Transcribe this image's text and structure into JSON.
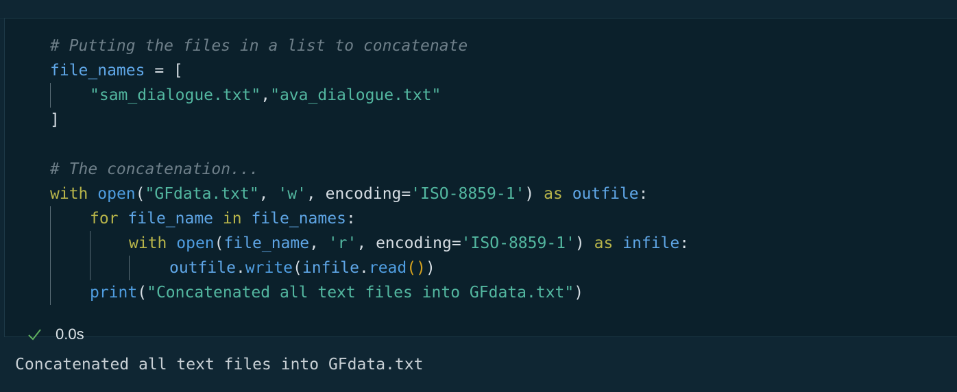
{
  "cell": {
    "code_lines": [
      {
        "tokens": [
          {
            "cls": "cmt",
            "text": "# Putting the files in a list to concatenate"
          }
        ]
      },
      {
        "tokens": [
          {
            "cls": "var",
            "text": "file_names"
          },
          {
            "cls": "op",
            "text": " = "
          },
          {
            "cls": "par",
            "text": "["
          }
        ]
      },
      {
        "tokens": [
          {
            "cls": "str",
            "text": "\"sam_dialogue.txt\""
          },
          {
            "cls": "op",
            "text": ","
          },
          {
            "cls": "str",
            "text": "\"ava_dialogue.txt\""
          }
        ]
      },
      {
        "tokens": [
          {
            "cls": "par",
            "text": "]"
          }
        ]
      },
      {
        "tokens": []
      },
      {
        "tokens": [
          {
            "cls": "cmt",
            "text": "# The concatenation..."
          }
        ]
      },
      {
        "tokens": [
          {
            "cls": "kw",
            "text": "with"
          },
          {
            "cls": "op",
            "text": " "
          },
          {
            "cls": "fn",
            "text": "open"
          },
          {
            "cls": "par",
            "text": "("
          },
          {
            "cls": "str",
            "text": "\"GFdata.txt\""
          },
          {
            "cls": "op",
            "text": ", "
          },
          {
            "cls": "str",
            "text": "'w'"
          },
          {
            "cls": "op",
            "text": ", encoding="
          },
          {
            "cls": "str",
            "text": "'ISO-8859-1'"
          },
          {
            "cls": "par",
            "text": ")"
          },
          {
            "cls": "op",
            "text": " "
          },
          {
            "cls": "kw",
            "text": "as"
          },
          {
            "cls": "op",
            "text": " "
          },
          {
            "cls": "var",
            "text": "outfile"
          },
          {
            "cls": "op",
            "text": ":"
          }
        ]
      },
      {
        "tokens": [
          {
            "cls": "kw",
            "text": "for"
          },
          {
            "cls": "op",
            "text": " "
          },
          {
            "cls": "var",
            "text": "file_name"
          },
          {
            "cls": "op",
            "text": " "
          },
          {
            "cls": "kw",
            "text": "in"
          },
          {
            "cls": "op",
            "text": " "
          },
          {
            "cls": "var",
            "text": "file_names"
          },
          {
            "cls": "op",
            "text": ":"
          }
        ]
      },
      {
        "tokens": [
          {
            "cls": "kw",
            "text": "with"
          },
          {
            "cls": "op",
            "text": " "
          },
          {
            "cls": "fn",
            "text": "open"
          },
          {
            "cls": "par",
            "text": "("
          },
          {
            "cls": "var",
            "text": "file_name"
          },
          {
            "cls": "op",
            "text": ", "
          },
          {
            "cls": "str",
            "text": "'r'"
          },
          {
            "cls": "op",
            "text": ", encoding="
          },
          {
            "cls": "str",
            "text": "'ISO-8859-1'"
          },
          {
            "cls": "par",
            "text": ")"
          },
          {
            "cls": "op",
            "text": " "
          },
          {
            "cls": "kw",
            "text": "as"
          },
          {
            "cls": "op",
            "text": " "
          },
          {
            "cls": "var",
            "text": "infile"
          },
          {
            "cls": "op",
            "text": ":"
          }
        ]
      },
      {
        "tokens": [
          {
            "cls": "var",
            "text": "outfile"
          },
          {
            "cls": "op",
            "text": "."
          },
          {
            "cls": "fn",
            "text": "write"
          },
          {
            "cls": "par",
            "text": "("
          },
          {
            "cls": "var",
            "text": "infile"
          },
          {
            "cls": "op",
            "text": "."
          },
          {
            "cls": "fn",
            "text": "read"
          },
          {
            "cls": "par2",
            "text": "()"
          },
          {
            "cls": "par",
            "text": ")"
          }
        ]
      },
      {
        "tokens": [
          {
            "cls": "fn",
            "text": "print"
          },
          {
            "cls": "par",
            "text": "("
          },
          {
            "cls": "str",
            "text": "\"Concatenated all text files into GFdata.txt\""
          },
          {
            "cls": "par",
            "text": ")"
          }
        ]
      }
    ],
    "status": {
      "icon": "check-icon",
      "duration": "0.0s",
      "color": "#5fb05f"
    }
  },
  "output": {
    "text": "Concatenated all text files into GFdata.txt"
  },
  "colors": {
    "background": "#0f2633",
    "cell_background": "#0b202b",
    "comment": "#6e7f89",
    "keyword": "#b8b54a",
    "function": "#4f9de0",
    "variable": "#5fa6e6",
    "string": "#53b7a0"
  }
}
